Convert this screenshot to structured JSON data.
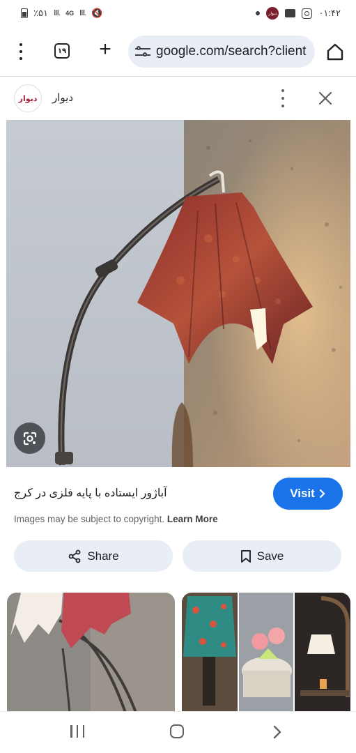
{
  "status_bar": {
    "time": "۰۱:۴۲",
    "battery": "٪۵۱",
    "network": "4G",
    "app_badge": "دیوار"
  },
  "browser": {
    "tab_count": "۱۹",
    "url": "google.com/search?client",
    "icons": [
      "more-vert-icon",
      "tab-switcher-icon",
      "new-tab-plus-icon",
      "site-settings-tune-icon",
      "home-icon"
    ]
  },
  "source": {
    "logo_text": "دیوار",
    "name": "دیوار",
    "brand_color": "#a62033"
  },
  "result": {
    "caption": "آباژور ایستاده با پایه فلزی در کرج",
    "visit_label": "Visit",
    "copyright_text": "Images may be subject to copyright.",
    "learn_more": "Learn More",
    "share_label": "Share",
    "save_label": "Save",
    "accent_color": "#1a73e8"
  },
  "navigation": {
    "icons": [
      "recent-apps-icon",
      "home-nav-icon",
      "back-nav-icon"
    ]
  }
}
